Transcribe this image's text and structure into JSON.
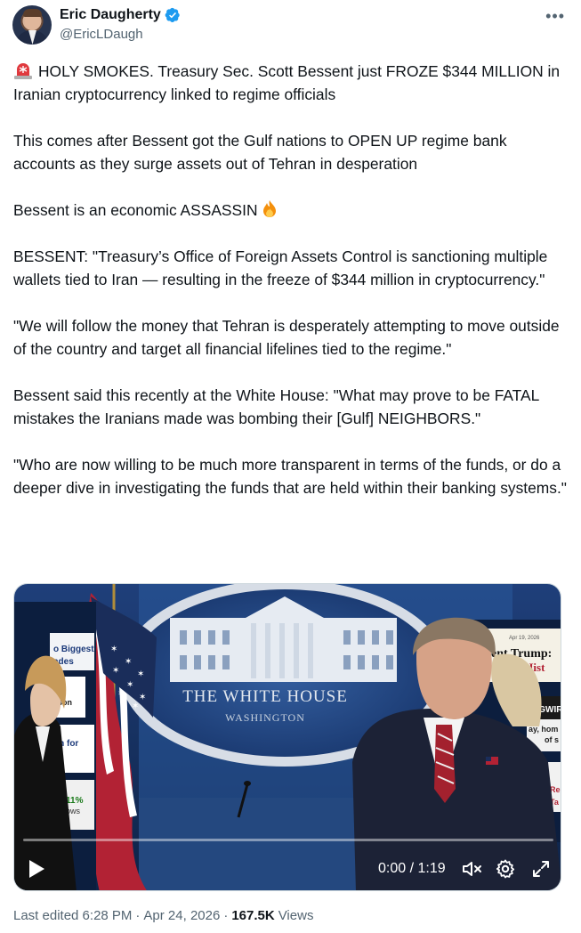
{
  "author": {
    "display_name": "Eric Daugherty",
    "handle": "@EricLDaugh",
    "verified": true,
    "avatar_icon": "avatar-photo"
  },
  "menu": {
    "more_label": "•••"
  },
  "tweet": {
    "paragraphs": [
      "HOLY SMOKES. Treasury Sec. Scott Bessent just FROZE $344 MILLION in Iranian cryptocurrency linked to regime officials",
      "This comes after Bessent got the Gulf nations to OPEN UP regime bank accounts as they surge assets out of Tehran in desperation",
      "Bessent is an economic ASSASSIN",
      "BESSENT: \"Treasury’s Office of Foreign Assets Control is sanctioning multiple wallets tied to Iran — resulting in the freeze of $344 million in cryptocurrency.\"",
      "\"We will follow the money that Tehran is desperately attempting to move outside of the country and target all financial lifelines tied to the regime.\"",
      "Bessent said this recently at the White House: \"What may prove to be FATAL mistakes the Iranians made was bombing their [Gulf] NEIGHBORS.\"",
      "\"Who are now willing to be much more transparent in terms of the funds, or do a deeper dive in investigating the funds that are held within their banking systems.\""
    ],
    "leading_icon": "siren-emoji",
    "inline_icon": "fire-emoji"
  },
  "video": {
    "time_label": "0:00 / 1:19",
    "progress": 0,
    "seal_line1": "THE WHITE HOUSE",
    "seal_line2": "WASHINGTON",
    "left_panel_labels": [
      "o Biggest",
      "ades",
      "ason",
      "on for",
      "11%",
      "ows"
    ],
    "right_panel_labels": [
      "all",
      "Apr 19, 2026",
      "ent Trump:",
      "tter in Hist",
      "NGWIR",
      "ay, hom",
      "of s",
      "Re",
      "Ta"
    ],
    "controls": {
      "play_icon": "play-icon",
      "mute_icon": "muted-speaker-icon",
      "settings_icon": "gear-icon",
      "fullscreen_icon": "fullscreen-icon"
    }
  },
  "meta": {
    "edited_label": "Last edited 6:28 PM",
    "date_label": "Apr 24, 2026",
    "separator": "·",
    "views_count": "167.5K",
    "views_label": "Views"
  }
}
